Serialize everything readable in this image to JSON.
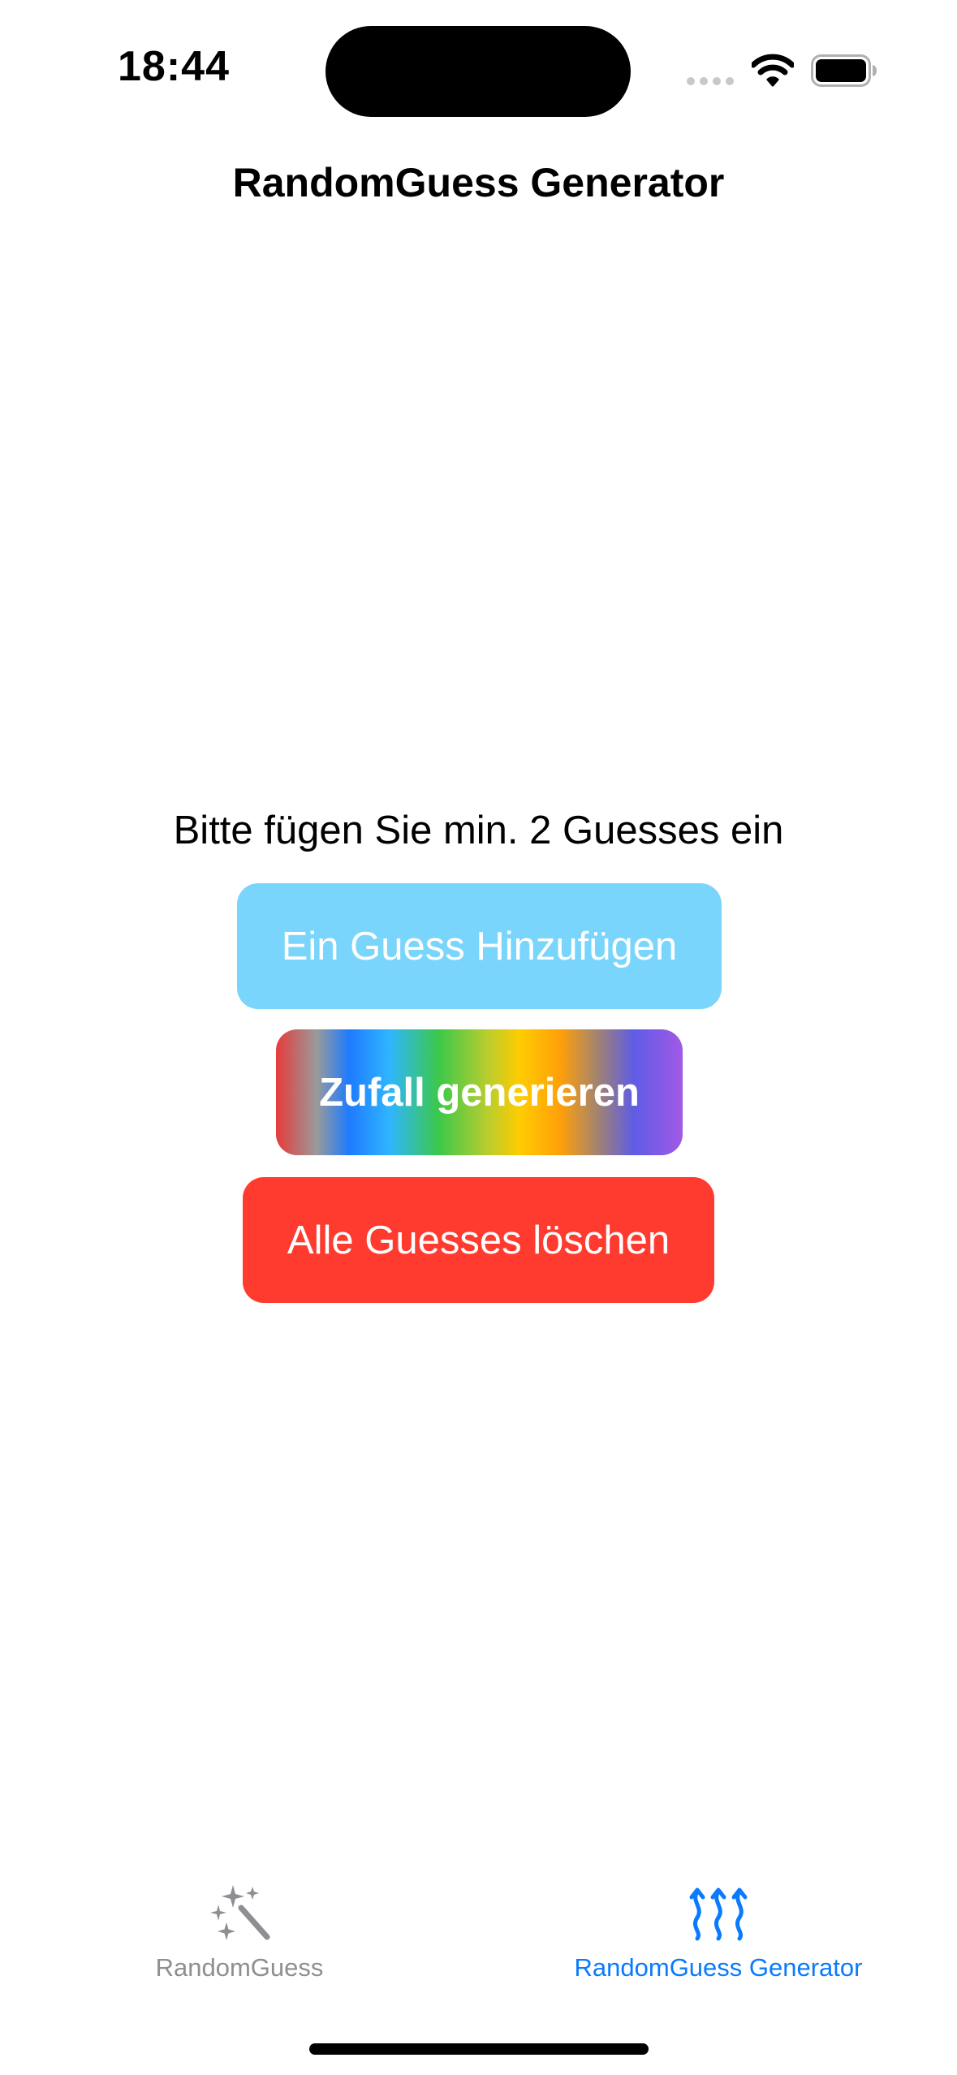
{
  "status_bar": {
    "time": "18:44"
  },
  "nav": {
    "title": "RandomGuess Generator"
  },
  "main": {
    "prompt": "Bitte fügen Sie min. 2 Guesses ein",
    "add_button_label": "Ein Guess Hinzufügen",
    "random_button_label": "Zufall generieren",
    "clear_button_label": "Alle Guesses löschen"
  },
  "tabs": [
    {
      "label": "RandomGuess",
      "icon": "magic-wand-icon",
      "selected": false
    },
    {
      "label": "RandomGuess Generator",
      "icon": "heat-waves-icon",
      "selected": true
    }
  ],
  "colors": {
    "accent": "#0a7aff",
    "add_button": "#79d5fb",
    "clear_button": "#ff3b30",
    "tab_inactive": "#8e8e93"
  }
}
